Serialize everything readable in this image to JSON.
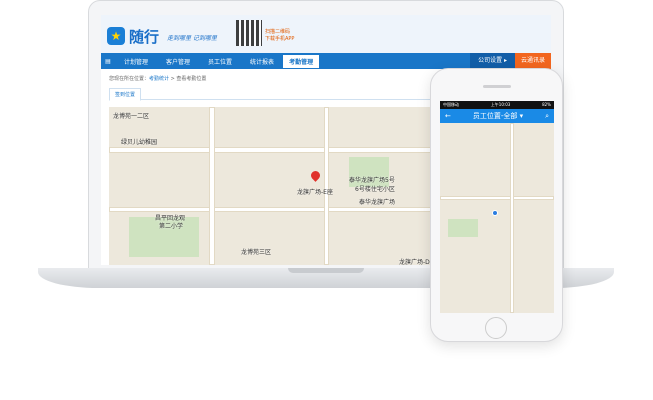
{
  "laptop": {
    "brand": "随行",
    "slogan": "走到哪里 记到哪里",
    "qr_text_1": "扫描二维码",
    "qr_text_2": "下载手机APP",
    "nav": [
      "计划管理",
      "客户管理",
      "员工位置",
      "统计报表",
      "考勤管理"
    ],
    "nav_active": "考勤管理",
    "company_settings": "公司设置 ▸",
    "contacts": "云通讯录",
    "breadcrumb_prefix": "您现在所在位置：",
    "breadcrumb_link": "考勤统计",
    "breadcrumb_current": " > 查看考勤位置",
    "tab": "签到位置",
    "map_labels": [
      "龙博苑一二区",
      "绿贝儿幼稚园",
      "龙旗广场-E座",
      "泰华龙旗广场5号",
      "6号楼住宅小区",
      "泰华龙旗广场",
      "昌平回龙观",
      "第二小学",
      "龙博苑三区",
      "龙旗广场-D座"
    ]
  },
  "phone": {
    "carrier": "中国移动",
    "time": "上午10:03",
    "battery": "82%",
    "title": "员工位置-全部 ▾"
  },
  "colors": {
    "nav": "#1976c8",
    "accent": "#f2661f",
    "pin": "#e0322b"
  }
}
